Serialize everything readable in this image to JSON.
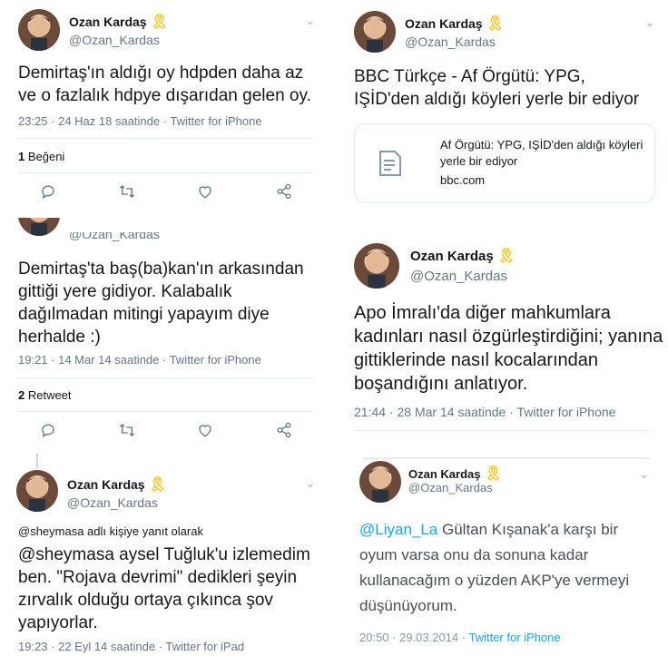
{
  "ribbon_color": "#f5c518",
  "tweets": {
    "t1": {
      "name": "Ozan Kardaş",
      "handle": "@Ozan_Kardas",
      "text": "Demirtaş'ın aldığı oy hdpden daha az ve o fazlalık hdpye dışarıdan gelen oy.",
      "meta": "23:25 · 24 Haz 18 saatinde · Twitter for iPhone",
      "stat_count": "1",
      "stat_label": " Beğeni"
    },
    "t2": {
      "handle_partial": "@Ozan_Kardas",
      "text": "Demirtaş'ta baş(ba)kan'ın arkasından gittiği yere gidiyor. Kalabalık dağılmadan mitingi yapayım diye herhalde :)",
      "meta": "19:21 · 14 Mar 14 saatinde · Twitter for iPhone",
      "stat_count": "2",
      "stat_label": " Retweet"
    },
    "t3": {
      "name": "Ozan Kardaş",
      "handle": "@Ozan_Kardas",
      "reply_context": "@sheymasa adlı kişiye yanıt olarak",
      "text": "@sheymasa aysel Tuğluk'u izlemedim ben. \"Rojava devrimi\" dedikleri şeyin zırvalık olduğu ortaya çıkınca şov yapıyorlar.",
      "meta": "19:23 · 22 Eyl 14 saatinde · Twitter for iPad"
    },
    "t4": {
      "name": "Ozan Kardaş",
      "handle": "@Ozan_Kardas",
      "text": "BBC Türkçe - Af Örgütü: YPG, IŞİD'den aldığı köyleri yerle bir ediyor",
      "card_title": "Af Örgütü: YPG, IŞİD'den aldığı köyleri yerle bir ediyor",
      "card_domain": "bbc.com"
    },
    "t5": {
      "name": "Ozan Kardaş",
      "handle": "@Ozan_Kardas",
      "text": "Apo İmralı'da diğer mahkumlara kadınları nasıl özgürleştirdiğini; yanına gittiklerinde nasıl kocalarından boşandığını anlatıyor.",
      "meta": "21:44 · 28 Mar 14 saatinde · Twitter for iPhone"
    },
    "t6": {
      "name": "Ozan Kardaş",
      "handle": "@Ozan_Kardas",
      "mention": "@Liyan_La",
      "text": " Gültan Kışanak'a karşı bir oyum varsa onu da sonuna kadar kullanacağım o yüzden AKP'ye vermeyi düşünüyorum.",
      "meta_date": "20:50 · 29.03.2014 · ",
      "meta_source": "Twitter for iPhone"
    }
  }
}
